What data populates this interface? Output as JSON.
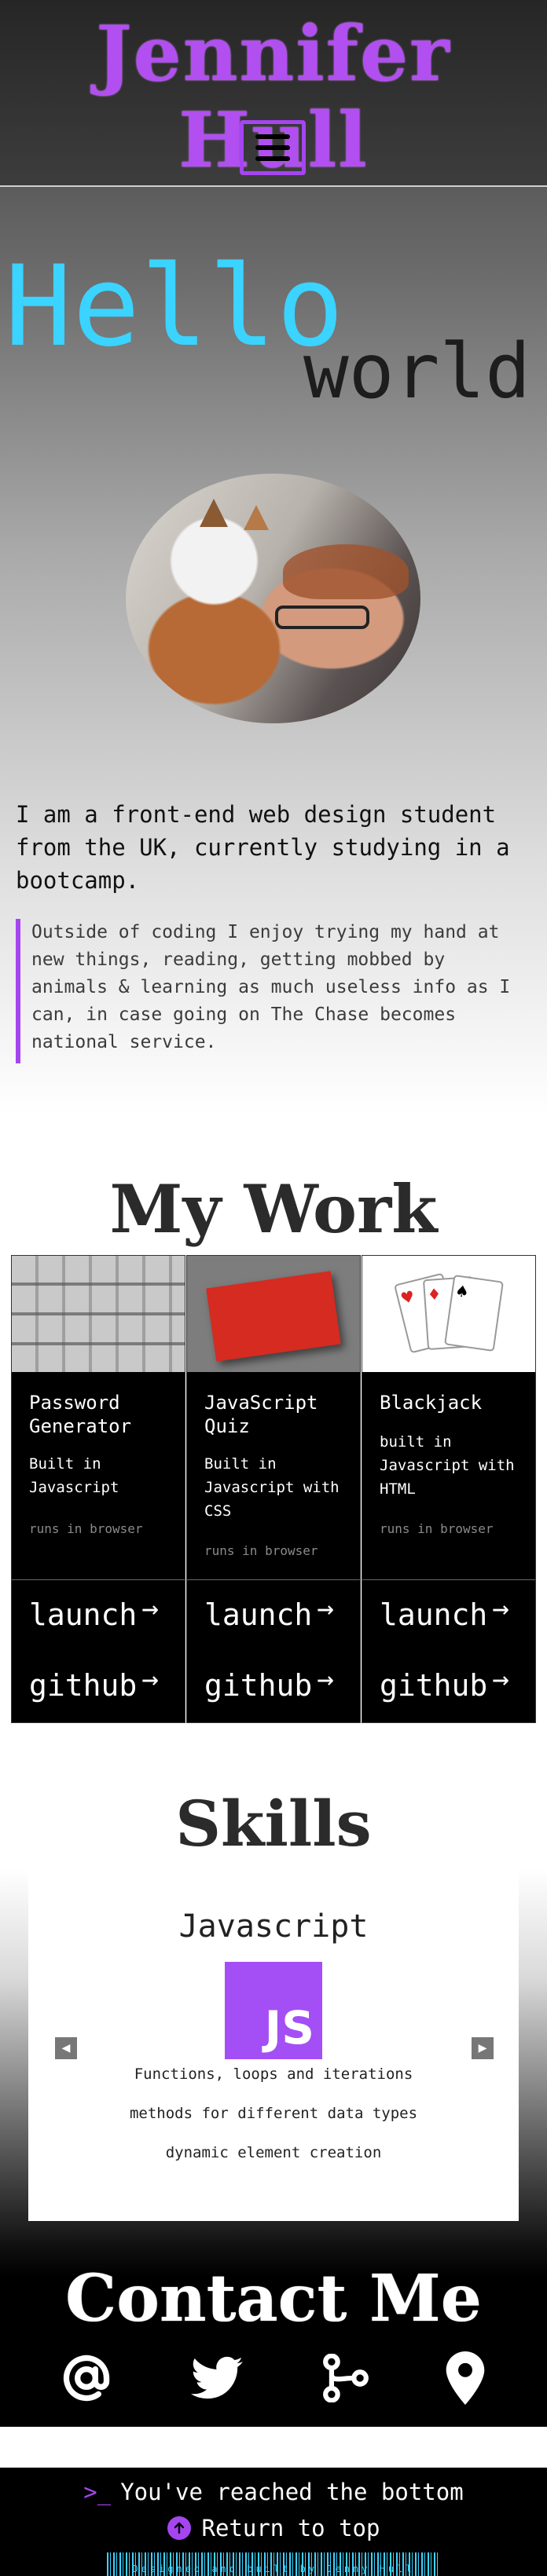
{
  "header": {
    "brand": "Jennifer Hull",
    "menu_icon": "hamburger-menu-icon",
    "accent_color": "#a545f0"
  },
  "hero": {
    "hello": "Hello",
    "world": "world",
    "hello_color": "#3bd3ff"
  },
  "about": {
    "intro": "I am a front-end web design student from the UK, currently studying in a bootcamp.",
    "quote": "Outside of coding I enjoy trying my hand at new things, reading, getting mobbed by animals & learning as much useless info as I can, in case going on The Chase becomes national service."
  },
  "work": {
    "title": "My Work",
    "projects": [
      {
        "name": "Password Generator",
        "desc": "Built in Javascript",
        "runs": "runs in browser",
        "launch": "launch",
        "github": "github"
      },
      {
        "name": "JavaScript Quiz",
        "desc": "Built in Javascript with CSS",
        "runs": "runs in browser",
        "launch": "launch",
        "github": "github"
      },
      {
        "name": "Blackjack",
        "desc": "built in Javascript with HTML",
        "runs": "runs in browser",
        "launch": "launch",
        "github": "github"
      }
    ]
  },
  "skills": {
    "title": "Skills",
    "current": {
      "name": "Javascript",
      "logo": "JS",
      "logo_color": "#a34ff5",
      "lines": [
        "Functions, loops and iterations",
        "methods for different data types",
        "dynamic element creation"
      ]
    },
    "prev_icon": "chevron-left-icon",
    "next_icon": "chevron-right-icon"
  },
  "contact": {
    "title": "Contact Me",
    "icons": [
      "at-sign-icon",
      "twitter-icon",
      "github-branch-icon",
      "location-pin-icon"
    ]
  },
  "footer": {
    "prompt": ">_",
    "bottom_text": "You've reached the bottom",
    "top_link": "Return to top",
    "credit": "Designed and built by Jenny Hull"
  }
}
